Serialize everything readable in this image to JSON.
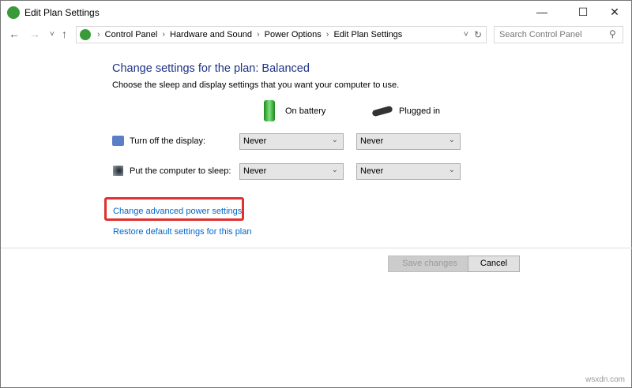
{
  "window": {
    "title": "Edit Plan Settings",
    "minimize": "—",
    "maximize": "☐",
    "close": "✕"
  },
  "nav": {
    "back": "←",
    "forward": "→",
    "recent": "˅",
    "up": "↑",
    "refresh": "↻",
    "dropdown": "˅"
  },
  "breadcrumb": [
    "Control Panel",
    "Hardware and Sound",
    "Power Options",
    "Edit Plan Settings"
  ],
  "search": {
    "placeholder": "Search Control Panel"
  },
  "main": {
    "heading": "Change settings for the plan: Balanced",
    "subheading": "Choose the sleep and display settings that you want your computer to use.",
    "col_battery": "On battery",
    "col_plugged": "Plugged in",
    "rows": [
      {
        "label": "Turn off the display:",
        "battery": "Never",
        "plugged": "Never"
      },
      {
        "label": "Put the computer to sleep:",
        "battery": "Never",
        "plugged": "Never"
      }
    ],
    "link_advanced": "Change advanced power settings",
    "link_restore": "Restore default settings for this plan",
    "save": "Save changes",
    "cancel": "Cancel"
  },
  "watermark": "wsxdn.com",
  "colors": {
    "heading": "#1e3287",
    "link": "#0066cc",
    "highlight": "#e03030"
  }
}
